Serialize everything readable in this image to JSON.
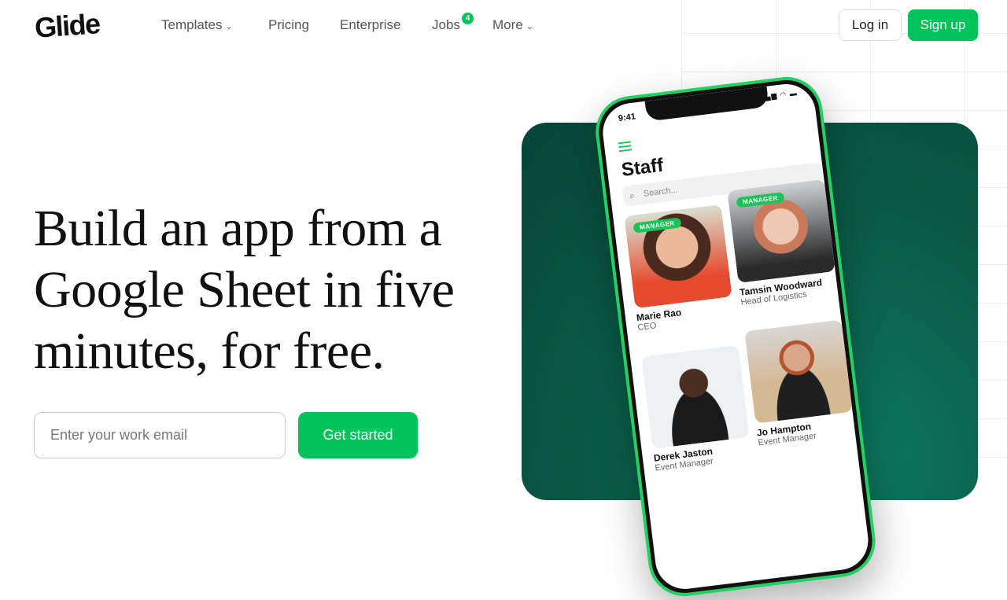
{
  "header": {
    "logo": "Glide",
    "nav": [
      {
        "label": "Templates",
        "chevron": true
      },
      {
        "label": "Pricing"
      },
      {
        "label": "Enterprise"
      },
      {
        "label": "Jobs",
        "badge": "4"
      },
      {
        "label": "More",
        "chevron": true
      }
    ],
    "login": "Log in",
    "signup": "Sign up"
  },
  "hero": {
    "headline": "Build an app from a Google Sheet in five minutes, for free.",
    "email_placeholder": "Enter your work email",
    "cta": "Get started"
  },
  "phone": {
    "time": "9:41",
    "title": "Staff",
    "search_placeholder": "Search...",
    "staff": [
      {
        "name": "Marie Rao",
        "role": "CEO",
        "badge": "MANAGER"
      },
      {
        "name": "Tamsin Woodward",
        "role": "Head of Logistics",
        "badge": "MANAGER"
      },
      {
        "name": "Derek Jaston",
        "role": "Event Manager"
      },
      {
        "name": "Jo Hampton",
        "role": "Event Manager"
      }
    ]
  },
  "colors": {
    "brand": "#00c35a",
    "panel": "#0a5e4a"
  }
}
